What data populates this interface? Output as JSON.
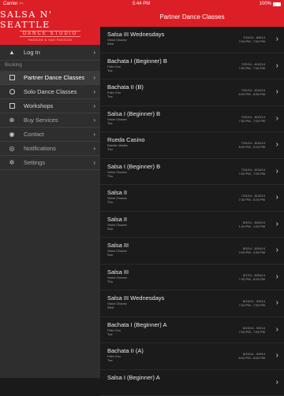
{
  "status": {
    "carrier": "Carrier",
    "time": "5:44 PM",
    "battery": "100%"
  },
  "sidebar": {
    "logo": {
      "title": "SALSA N' SEATTLE",
      "sub": "DANCE STUDIO",
      "tagline": "PASSION & HAS PASSION"
    },
    "login": "Log In",
    "section": "Booking",
    "items": [
      {
        "label": "Partner Dance Classes",
        "icon": "square-icon"
      },
      {
        "label": "Solo Dance Classes",
        "icon": "circle-icon"
      },
      {
        "label": "Workshops",
        "icon": "square-icon"
      },
      {
        "label": "Buy Services",
        "icon": "plus-circle-icon"
      },
      {
        "label": "Contact",
        "icon": "chat-icon"
      },
      {
        "label": "Notifications",
        "icon": "bell-icon"
      },
      {
        "label": "Settings",
        "icon": "gear-icon"
      }
    ]
  },
  "main": {
    "title": "Partner Dance Classes",
    "classes": [
      {
        "title": "Salsa III Wednesdays",
        "instructor": "Victor Chavez",
        "day": "Wed",
        "dates": "7/16/14 - 8/6/14",
        "time": "7:00 PM - 7:50 PM"
      },
      {
        "title": "Bachata I (Beginner) B",
        "instructor": "Felix Chu",
        "day": "Tue",
        "dates": "7/22/14 - 8/12/14",
        "time": "7:00 PM - 7:50 PM"
      },
      {
        "title": "Bachata II (B)",
        "instructor": "Felix Chu",
        "day": "Tue",
        "dates": "7/22/14 - 8/12/14",
        "time": "8:00 PM - 8:50 PM"
      },
      {
        "title": "Salsa I (Beginner) B",
        "instructor": "Victor Chavez",
        "day": "Tue",
        "dates": "7/22/14 - 8/12/14",
        "time": "7:30 PM - 7:50 PM"
      },
      {
        "title": "Rueda Casino",
        "instructor": "Ramier Valdes",
        "day": "Thu",
        "dates": "7/24/14 - 8/14/14",
        "time": "8:30 PM - 9:20 PM"
      },
      {
        "title": "Salsa I (Beginner) B",
        "instructor": "Victor Chavez",
        "day": "Thu",
        "dates": "7/24/14 - 8/14/14",
        "time": "7:00 PM - 7:50 PM"
      },
      {
        "title": "Salsa II",
        "instructor": "Victor Chavez",
        "day": "Thu",
        "dates": "7/24/14 - 8/14/14",
        "time": "7:30 PM - 8:20 PM"
      },
      {
        "title": "Salsa II",
        "instructor": "Victor Chavez",
        "day": "Sun",
        "dates": "8/3/14 - 8/24/14",
        "time": "1:00 PM - 1:50 PM"
      },
      {
        "title": "Salsa III",
        "instructor": "Victor Chavez",
        "day": "Sun",
        "dates": "8/3/14 - 8/24/14",
        "time": "2:00 PM - 2:50 PM"
      },
      {
        "title": "Salsa III",
        "instructor": "Victor Chavez",
        "day": "Thu",
        "dates": "8/7/14 - 8/28/14",
        "time": "7:30 PM - 8:20 PM"
      },
      {
        "title": "Salsa III Wednesdays",
        "instructor": "Victor Chavez",
        "day": "Wed",
        "dates": "8/13/14 - 9/3/14",
        "time": "7:00 PM - 7:50 PM"
      },
      {
        "title": "Bachata I (Beginner) A",
        "instructor": "Felix Chu",
        "day": "Tue",
        "dates": "8/19/14 - 9/9/14",
        "time": "7:00 PM - 7:50 PM"
      },
      {
        "title": "Bachata II (A)",
        "instructor": "Felix Chu",
        "day": "Tue",
        "dates": "8/19/14 - 9/9/14",
        "time": "8:00 PM - 8:50 PM"
      },
      {
        "title": "Salsa I (Beginner) A",
        "instructor": "",
        "day": "",
        "dates": "",
        "time": ""
      }
    ]
  },
  "colors": {
    "accent": "#dc1f26",
    "sidebar_bg": "#2e2e2e",
    "list_bg": "#1b1b1b"
  }
}
